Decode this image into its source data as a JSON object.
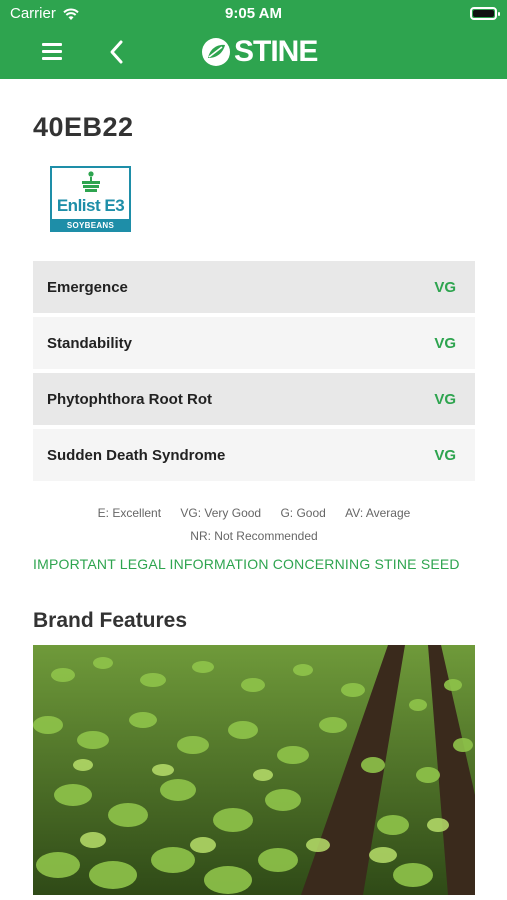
{
  "status_bar": {
    "carrier": "Carrier",
    "time": "9:05 AM"
  },
  "nav": {
    "brand": "STINE"
  },
  "product": {
    "name": "40EB22",
    "badge": {
      "line1": "Enlist E3",
      "line2": "SOYBEANS"
    }
  },
  "traits": [
    {
      "name": "Emergence",
      "value": "VG"
    },
    {
      "name": "Standability",
      "value": "VG"
    },
    {
      "name": "Phytophthora Root Rot",
      "value": "VG"
    },
    {
      "name": "Sudden Death Syndrome",
      "value": "VG"
    }
  ],
  "legend": {
    "items": [
      "E: Excellent",
      "VG: Very Good",
      "G: Good",
      "AV: Average"
    ],
    "last": "NR: Not Recommended"
  },
  "legal_link": "IMPORTANT LEGAL INFORMATION CONCERNING STINE SEED",
  "brand_features_title": "Brand Features",
  "colors": {
    "primary": "#2ea44f",
    "badge": "#1e8ea8"
  }
}
